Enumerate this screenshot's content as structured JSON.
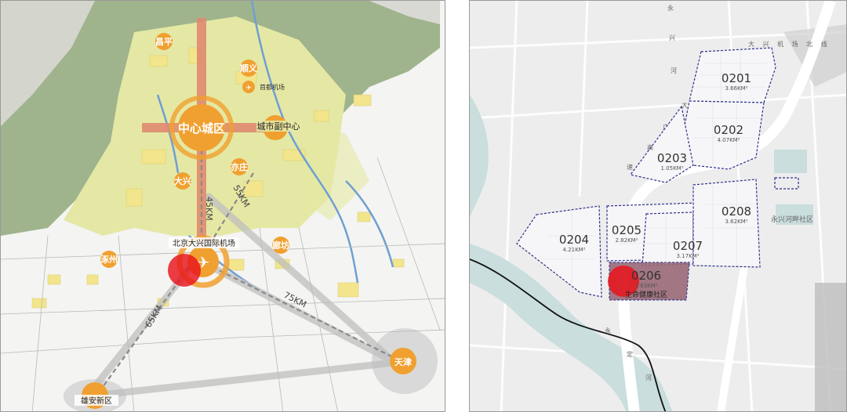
{
  "regional_map": {
    "center_label": "中心城区",
    "sub_center_label": "城市副中心",
    "airport_label": "北京大兴国际机场",
    "capital_airport_label": "首都机场",
    "towns": {
      "changping": "昌平",
      "shunyi": "顺义",
      "yizhuang": "亦庄",
      "daxing": "大兴",
      "zhuozhou": "涿州",
      "langfang": "廊坊",
      "tianjin": "天津",
      "xiongan": "雄安新区"
    },
    "distances": {
      "d45": "45KM",
      "d55": "55KM",
      "d65": "65KM",
      "d75": "75KM"
    },
    "colors": {
      "mountain": "#8fa87a",
      "urban_zone": "#e4e8a4",
      "built_area": "#f2e58c",
      "water": "#6f9fd2",
      "marker": "#f0a030",
      "axis": "#e08a70",
      "highlight": "#e8141b"
    }
  },
  "district_map": {
    "top_road_label": "大 兴 机 场 北 线",
    "left_road_chars": [
      "永",
      "兴",
      "河"
    ],
    "mid_road_chars": [
      "大",
      "广",
      "高",
      "速"
    ],
    "river_chars": [
      "永",
      "定",
      "河"
    ],
    "east_community": "永兴河畔社区",
    "zones": [
      {
        "code": "0201",
        "area": "3.66KM²"
      },
      {
        "code": "0202",
        "area": "4.07KM²"
      },
      {
        "code": "0203",
        "area": "1.05KM²"
      },
      {
        "code": "0204",
        "area": "4.21KM²"
      },
      {
        "code": "0205",
        "area": "2.82KM²"
      },
      {
        "code": "0206",
        "area": "2.83KM²",
        "name": "生命健康社区"
      },
      {
        "code": "0207",
        "area": "3.17KM²"
      },
      {
        "code": "0208",
        "area": "3.62KM²"
      }
    ],
    "colors": {
      "boundary": "#2c2f8a",
      "highlight_fill": "#9a6a78",
      "water": "#c9dedd",
      "river_line": "#111111",
      "marker": "#e8141b"
    }
  }
}
